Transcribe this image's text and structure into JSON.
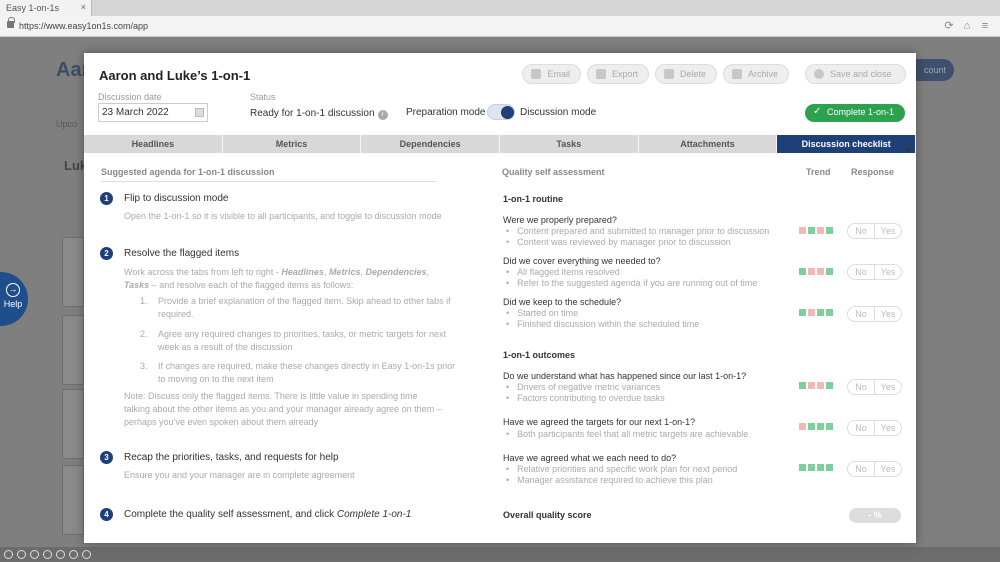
{
  "browser": {
    "tab_title": "Easy 1-on-1s",
    "tab_close": "×",
    "url": "https://www.easy1on1s.com/app"
  },
  "background": {
    "title": "Aar",
    "account": "count",
    "sub": "Upco",
    "lu": "Luk"
  },
  "help": {
    "icon": "→",
    "label": "Help"
  },
  "modal": {
    "title": "Aaron and Luke’s 1-on-1",
    "actions": {
      "email": "Email",
      "export": "Export",
      "delete": "Delete",
      "archive": "Archive",
      "save_close": "Save and close"
    },
    "date_label": "Discussion date",
    "date_value": "23 March 2022",
    "status_label": "Status",
    "status_value": "Ready for 1-on-1 discussion",
    "info_glyph": "i",
    "prep_mode": "Preparation mode",
    "disc_mode": "Discussion mode",
    "complete_check": "✓",
    "complete_label": "Complete 1-on-1",
    "tabs": [
      "Headlines",
      "Metrics",
      "Dependencies",
      "Tasks",
      "Attachments",
      "Discussion checklist"
    ],
    "active_tab": 5
  },
  "agenda": {
    "heading": "Suggested agenda for 1-on-1 discussion",
    "steps": [
      {
        "num": "1",
        "title": "Flip to discussion mode",
        "desc": "Open the 1-on-1 so it is visible to all participants, and toggle to discussion mode"
      },
      {
        "num": "2",
        "title": "Resolve the flagged items",
        "desc_a": "Work across the tabs from left to right - ",
        "desc_b": "Headlines",
        "desc_c": ", ",
        "desc_d": "Metrics",
        "desc_e": ", ",
        "desc_f": "Dependencies",
        "desc_g": ", ",
        "desc_h": "Tasks",
        "desc_i": " – and resolve each of the flagged items as follows:",
        "subs": [
          {
            "num": "1.",
            "text": "Provide a brief explanation of the flagged item. Skip ahead to other tabs if required."
          },
          {
            "num": "2.",
            "text": "Agree any required changes to priorities, tasks, or metric targets for next week as a result of the discussion"
          },
          {
            "num": "3.",
            "text": "If changes are required, make these changes directly in Easy 1-on-1s prior to moving on to the next item"
          }
        ],
        "note": "Note: Discuss only the flagged items. There is little value in spending time talking about the other items as you and your manager already agree on them – perhaps you’ve even spoken about them already"
      },
      {
        "num": "3",
        "title": "Recap the priorities, tasks, and requests for help",
        "desc": "Ensure you and your manager are in complete agreement"
      },
      {
        "num": "4",
        "title_a": "Complete the quality self assessment, and click ",
        "title_b": "Complete 1-on-1"
      }
    ]
  },
  "quality": {
    "heading": "Quality self assessment",
    "trend_label": "Trend",
    "response_label": "Response",
    "routine_heading": "1-on-1 routine",
    "outcomes_heading": "1-on-1 outcomes",
    "no": "No",
    "yes": "Yes",
    "questions": [
      {
        "q": "Were we properly prepared?",
        "bullets": [
          "Content prepared and submitted to manager prior to discussion",
          "Content was reviewed by manager prior to discussion"
        ],
        "trend": [
          "p",
          "g",
          "p",
          "g"
        ]
      },
      {
        "q": "Did we cover everything we needed to?",
        "bullets": [
          "All flagged items resolved",
          "Refer to the suggested agenda if you are running out of time"
        ],
        "trend": [
          "g",
          "p",
          "p",
          "g"
        ]
      },
      {
        "q": "Did we keep to the schedule?",
        "bullets": [
          "Started on time",
          "Finished discussion within the scheduled time"
        ],
        "trend": [
          "g",
          "p",
          "g",
          "g"
        ]
      },
      {
        "q": "Do we understand what has happened since our last 1-on-1?",
        "bullets": [
          "Drivers of negative metric variances",
          "Factors contributing to overdue tasks"
        ],
        "trend": [
          "g",
          "p",
          "p",
          "g"
        ]
      },
      {
        "q": "Have we agreed the targets for our next 1-on-1?",
        "bullets": [
          "Both participants feel that all metric targets are achievable"
        ],
        "trend": [
          "p",
          "g",
          "g",
          "g"
        ]
      },
      {
        "q": "Have we agreed what we each need to do?",
        "bullets": [
          "Relative priorities and specific work plan for next period",
          "Manager assistance required to achieve this plan"
        ],
        "trend": [
          "g",
          "g",
          "g",
          "g"
        ]
      }
    ],
    "overall_label": "Overall quality score",
    "overall_value": "- %"
  },
  "colors": {
    "accent_navy": "#1f3f78",
    "complete_green": "#2ca24f",
    "trend_green": "#7ed09b",
    "trend_pink": "#f2b8b8"
  }
}
